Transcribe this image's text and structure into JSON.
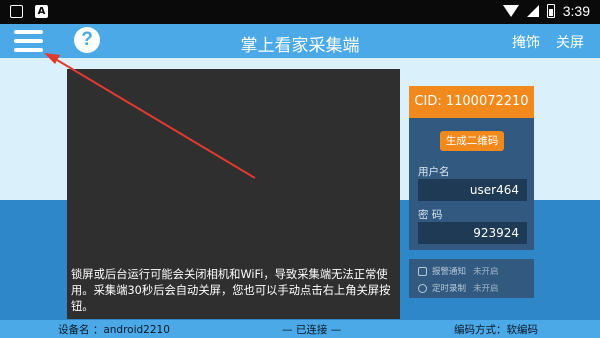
{
  "status_bar": {
    "time": "3:39",
    "left_icons": [
      "box-icon",
      "a-icon"
    ],
    "right_icons": [
      "wifi-icon",
      "signal-icon",
      "battery-icon"
    ]
  },
  "title_bar": {
    "title": "掌上看家采集端",
    "hide_label": "掩饰",
    "close_label": "关屏",
    "help_glyph": "?"
  },
  "preview": {
    "notice": "锁屏或后台运行可能会关闭相机和WiFi，导致采集端无法正常使用。采集端30秒后会自动关屏，您也可以手动点击右上角关屏按钮。"
  },
  "account_panel": {
    "cid": "CID: 1100072210",
    "qr_button": "生成二维码",
    "username_label": "用户名",
    "username_value": "user464",
    "password_label": "密 码",
    "password_value": "923924"
  },
  "options": [
    {
      "label": "报警通知",
      "state": "未开启",
      "icon": "alarm-icon"
    },
    {
      "label": "定时录制",
      "state": "未开启",
      "icon": "timer-icon"
    }
  ],
  "footer": {
    "device": "设备名 ：android2210",
    "connection": "— 已连接 —",
    "encoding": "编码方式：软编码"
  },
  "colors": {
    "accent_orange": "#f2891d",
    "title_blue": "#4aa9e6",
    "panel_navy": "#325a80",
    "annotation_red": "#e23a2e"
  }
}
